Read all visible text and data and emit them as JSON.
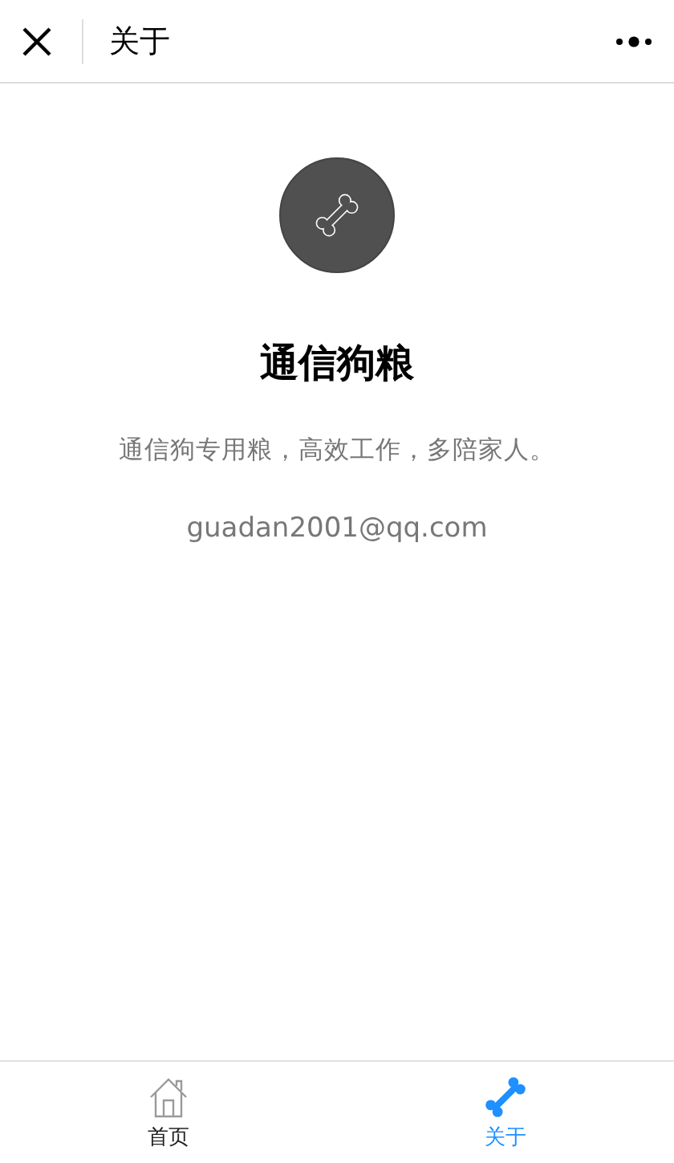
{
  "header": {
    "title": "关于"
  },
  "about": {
    "name": "通信狗粮",
    "description": "通信狗专用粮，高效工作，多陪家人。",
    "email": "guadan2001@qq.com"
  },
  "tab_bar": [
    {
      "label": "首页",
      "kind": "home",
      "selected": false
    },
    {
      "label": "关于",
      "kind": "bone",
      "selected": true
    }
  ]
}
